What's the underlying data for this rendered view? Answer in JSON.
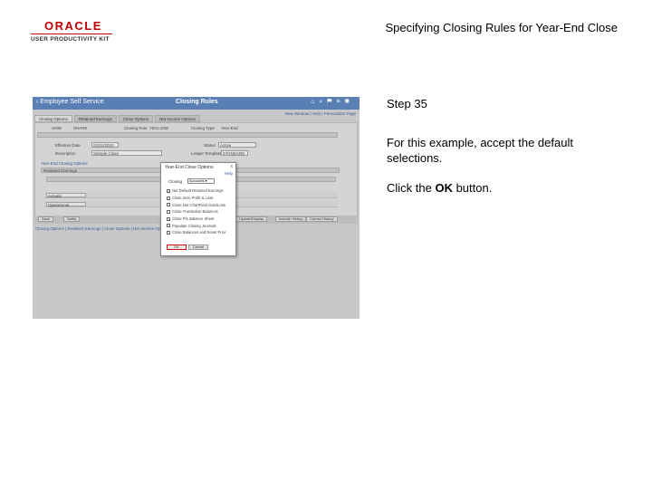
{
  "header": {
    "logo_brand": "ORACLE",
    "logo_product": "USER PRODUCTIVITY KIT",
    "doc_title": "Specifying Closing Rules for Year-End Close"
  },
  "screenshot": {
    "topbar": {
      "back_label": "Employee Self Service",
      "page_title": "Closing Rules"
    },
    "links": "New Window | Help | Personalize Page",
    "tabs": [
      "Closing Options",
      "Retained Earnings",
      "Close Options",
      "Net Income Options"
    ],
    "fields": {
      "setid_label": "SetID",
      "setid_value": "SHARE",
      "closing_type_label": "Closing Type",
      "closing_type_value": "Year-End",
      "closing_rule_label": "Closing Rule",
      "closing_rule_value": "YECLOSE",
      "effective_date_label": "Effective Date",
      "effective_date_value": "01/01/2010",
      "status_label": "Status",
      "status_value": "Active",
      "description_label": "Description",
      "description_value": "Sample Close",
      "ledger_template_label": "Ledger Template",
      "ledger_template_value": "STANDARD"
    },
    "section_label": "Year-End Closing Options",
    "grid_header": "Retained Earnings",
    "grid_rows": [
      "Actuals",
      "Operational"
    ],
    "buttons": [
      "Save",
      "Notify",
      "Update/Display",
      "Include History",
      "Correct History"
    ],
    "bottom_links": "Closing Options | Retained Earnings | Close Options | Net Income Options"
  },
  "modal": {
    "title": "Year-End Close Options",
    "close_glyph": "x",
    "help": "Help",
    "select_label": "Closing",
    "select_value": "Accounts",
    "options": [
      {
        "label": "Net Default Retained Earnings",
        "checked": true
      },
      {
        "label": "Close Zero Profit & Loss",
        "checked": false
      },
      {
        "label": "Close Not ChartField Gain/Loss",
        "checked": false
      },
      {
        "label": "Close Translation Balances",
        "checked": false
      },
      {
        "label": "Close P/L Balance Sheet",
        "checked": true
      },
      {
        "label": "Populate Closing Journals",
        "checked": false
      },
      {
        "label": "Close Balances and Reset Prior",
        "checked": false
      }
    ],
    "ok_label": "OK",
    "cancel_label": "Cancel"
  },
  "instructions": {
    "step": "Step 35",
    "line1": "For this example, accept the default selections.",
    "line2_prefix": "Click the ",
    "line2_bold": "OK",
    "line2_suffix": " button."
  },
  "colors": {
    "logo_red": "#c00000",
    "topbar_blue": "#5a7fb5",
    "link_blue": "#3a5a9a",
    "ok_highlight": "#d01010"
  }
}
